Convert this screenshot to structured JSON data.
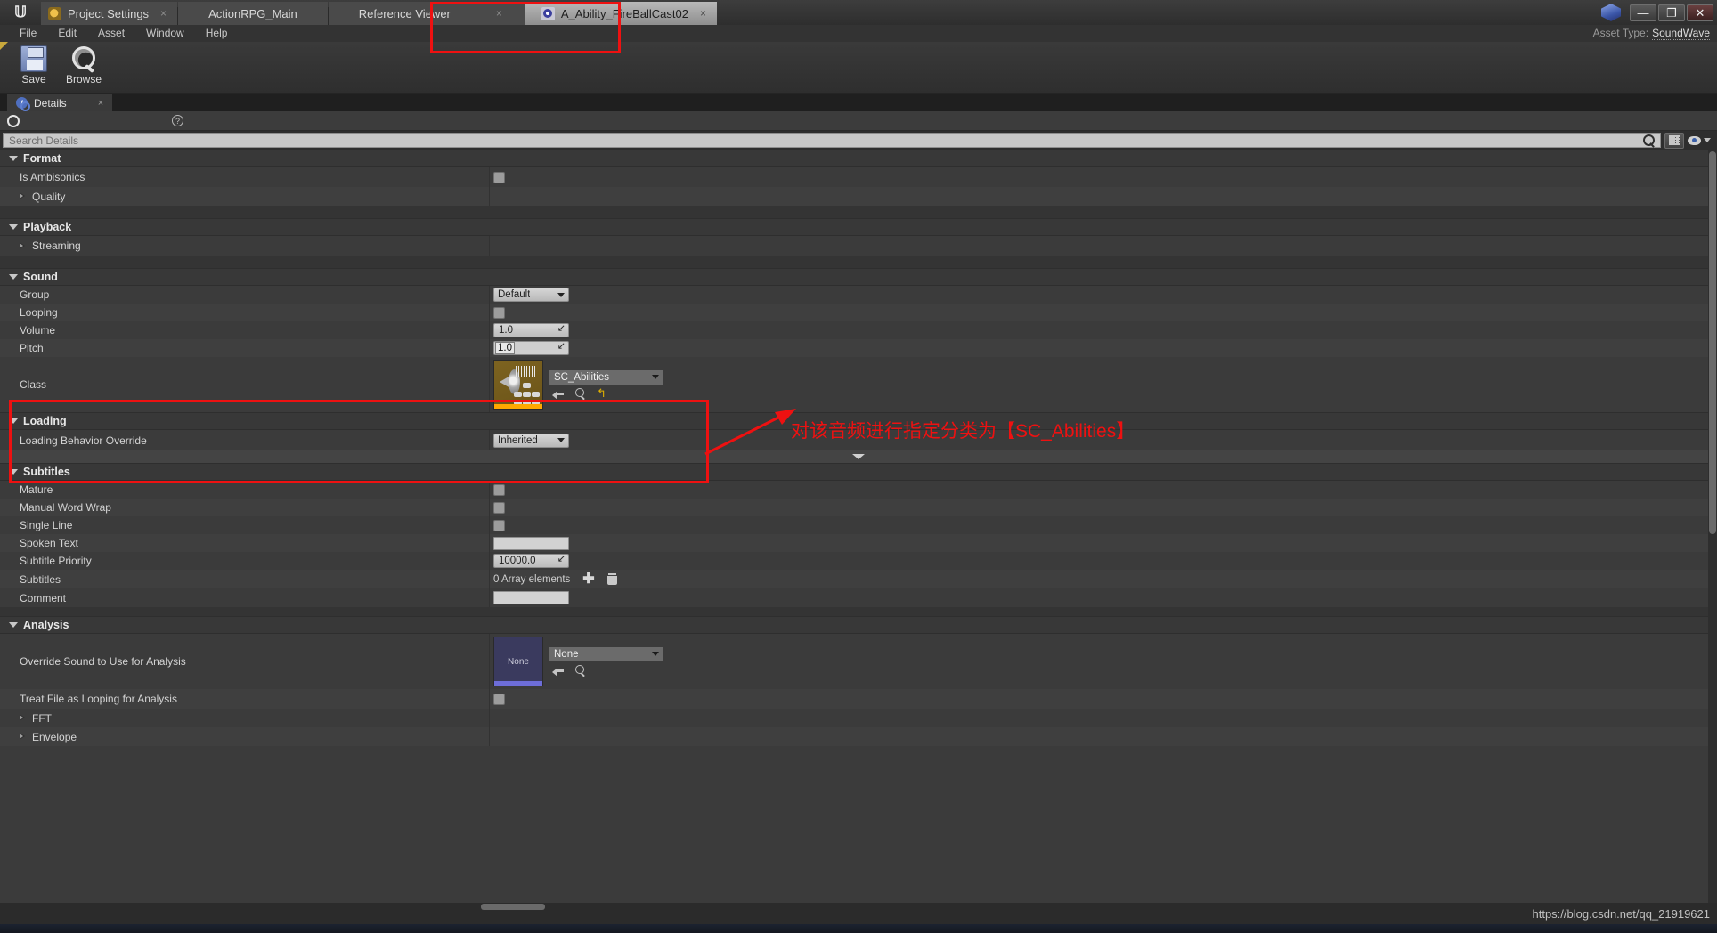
{
  "window": {
    "asset_type_label": "Asset Type:",
    "asset_type_value": "SoundWave",
    "minimize": "—",
    "restore": "❐",
    "close": "✕"
  },
  "tabs": [
    {
      "label": "Project Settings",
      "icon": "gear-icon",
      "active": false,
      "close": "×"
    },
    {
      "label": "ActionRPG_Main",
      "icon": "none",
      "active": false,
      "close": ""
    },
    {
      "label": "Reference Viewer",
      "icon": "none",
      "active": false,
      "close": "×"
    },
    {
      "label": "A_Ability_FireBallCast02",
      "icon": "sound-circle-icon",
      "active": true,
      "close": "×"
    }
  ],
  "menu": [
    "File",
    "Edit",
    "Asset",
    "Window",
    "Help"
  ],
  "toolbar": [
    {
      "label": "Save",
      "icon": "floppy-disk-icon"
    },
    {
      "label": "Browse",
      "icon": "magnifier-icon"
    }
  ],
  "panel": {
    "tab_label": "Details",
    "tab_close": "×",
    "help_glyph": "?"
  },
  "search": {
    "placeholder": "Search Details",
    "value": ""
  },
  "properties": [
    {
      "category": "Format",
      "rows": [
        {
          "name": "Is Ambisonics",
          "widget": "checkbox",
          "value": ""
        },
        {
          "name": "Quality",
          "widget": "expander",
          "value": ""
        }
      ]
    },
    {
      "category": "Playback",
      "rows": [
        {
          "name": "Streaming",
          "widget": "expander",
          "value": ""
        }
      ]
    },
    {
      "category": "Sound",
      "rows": [
        {
          "name": "Group",
          "widget": "combo",
          "value": "Default"
        },
        {
          "name": "Looping",
          "widget": "checkbox",
          "value": ""
        },
        {
          "name": "Volume",
          "widget": "number",
          "value": "1.0"
        },
        {
          "name": "Pitch",
          "widget": "number-editing",
          "value": "1.0"
        },
        {
          "name": "Class",
          "widget": "asset",
          "value": "SC_Abilities"
        }
      ]
    },
    {
      "category": "Loading",
      "rows": [
        {
          "name": "Loading Behavior Override",
          "widget": "combo",
          "value": "Inherited"
        }
      ]
    },
    {
      "category": "Subtitles",
      "rows": [
        {
          "name": "Mature",
          "widget": "checkbox",
          "value": ""
        },
        {
          "name": "Manual Word Wrap",
          "widget": "checkbox",
          "value": ""
        },
        {
          "name": "Single Line",
          "widget": "checkbox",
          "value": ""
        },
        {
          "name": "Spoken Text",
          "widget": "text",
          "value": ""
        },
        {
          "name": "Subtitle Priority",
          "widget": "number",
          "value": "10000.0"
        },
        {
          "name": "Subtitles",
          "widget": "array",
          "value": "0 Array elements"
        },
        {
          "name": "Comment",
          "widget": "text",
          "value": ""
        }
      ]
    },
    {
      "category": "Analysis",
      "rows": [
        {
          "name": "Override Sound to Use for Analysis",
          "widget": "asset-none",
          "value": "None"
        },
        {
          "name": "Treat File as Looping for Analysis",
          "widget": "checkbox",
          "value": ""
        },
        {
          "name": "FFT",
          "widget": "expander",
          "value": ""
        },
        {
          "name": "Envelope",
          "widget": "expander",
          "value": ""
        }
      ]
    }
  ],
  "asset_thumb": {
    "sound_class_name": "SC_Abilities",
    "none_label": "None",
    "none_value": "None"
  },
  "annotation": {
    "text": "对该音频进行指定分类为【SC_Abilities】",
    "color": "#ee1111"
  },
  "watermark": "https://blog.csdn.net/qq_21919621"
}
